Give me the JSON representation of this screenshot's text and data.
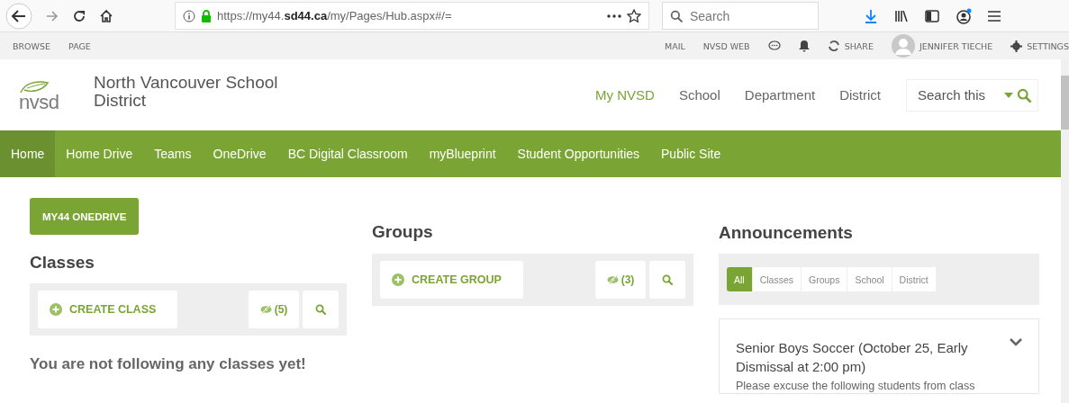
{
  "browser": {
    "url_prefix": "https://my44.",
    "url_domain": "sd44.ca",
    "url_path": "/my/Pages/Hub.aspx#/=",
    "search_placeholder": "Search"
  },
  "suite_bar": {
    "left_links": [
      "BROWSE",
      "PAGE"
    ],
    "right_links": [
      "MAIL",
      "NVSD WEB"
    ],
    "share": "SHARE",
    "user": "JENNIFER TIECHE",
    "settings": "SETTINGS"
  },
  "site": {
    "logo_text": "nvsd",
    "title": "North Vancouver School District",
    "search_placeholder": "Search this",
    "nav": [
      {
        "label": "My NVSD",
        "selected": true
      },
      {
        "label": "School",
        "selected": false
      },
      {
        "label": "Department",
        "selected": false
      },
      {
        "label": "District",
        "selected": false
      }
    ]
  },
  "top_nav": [
    {
      "label": "Home",
      "selected": true
    },
    {
      "label": "Home Drive",
      "selected": false
    },
    {
      "label": "Teams",
      "selected": false
    },
    {
      "label": "OneDrive",
      "selected": false
    },
    {
      "label": "BC Digital Classroom",
      "selected": false
    },
    {
      "label": "myBlueprint",
      "selected": false
    },
    {
      "label": "Student Opportunities",
      "selected": false
    },
    {
      "label": "Public Site",
      "selected": false
    }
  ],
  "onedrive_button": "MY44 ONEDRIVE",
  "classes": {
    "heading": "Classes",
    "create": "CREATE CLASS",
    "hidden_count": "(5)",
    "empty_message": "You are not following any classes yet!"
  },
  "groups": {
    "heading": "Groups",
    "create": "CREATE GROUP",
    "hidden_count": "(3)"
  },
  "announcements": {
    "heading": "Announcements",
    "filters": [
      {
        "label": "All",
        "selected": true
      },
      {
        "label": "Classes",
        "selected": false
      },
      {
        "label": "Groups",
        "selected": false
      },
      {
        "label": "School",
        "selected": false
      },
      {
        "label": "District",
        "selected": false
      }
    ],
    "items": [
      {
        "title": "Senior Boys Soccer (October 25, Early Dismissal at 2:00 pm)",
        "body": "Please excuse the following students from class"
      }
    ]
  }
}
